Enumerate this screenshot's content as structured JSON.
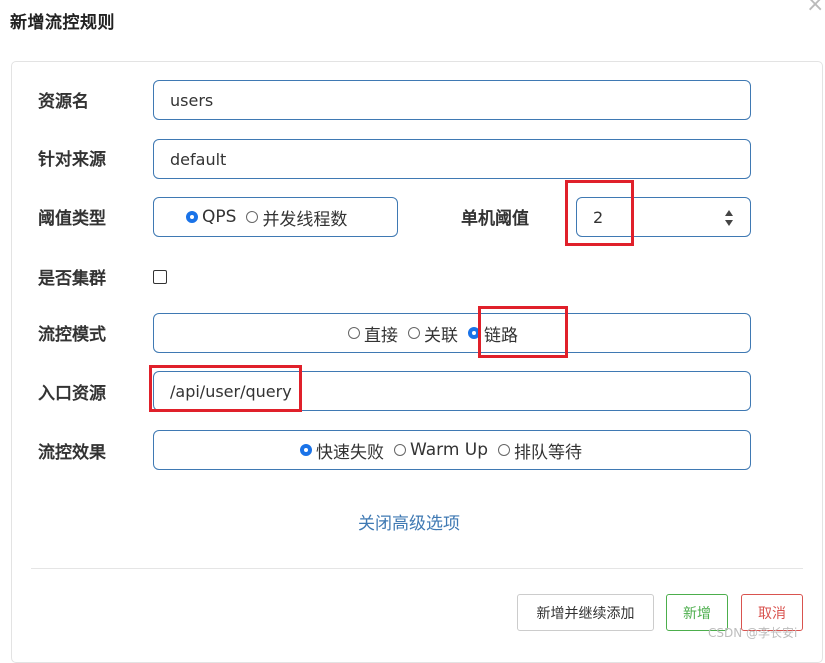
{
  "dialog": {
    "title": "新增流控规则"
  },
  "form": {
    "resource_name": {
      "label": "资源名",
      "value": "users"
    },
    "limit_app": {
      "label": "针对来源",
      "value": "default"
    },
    "grade": {
      "label": "阈值类型",
      "options": [
        "QPS",
        "并发线程数"
      ],
      "selected": "QPS"
    },
    "threshold": {
      "label": "单机阈值",
      "value": "2"
    },
    "cluster": {
      "label": "是否集群",
      "checked": false
    },
    "strategy": {
      "label": "流控模式",
      "options": [
        "直接",
        "关联",
        "链路"
      ],
      "selected": "链路"
    },
    "ref_resource": {
      "label": "入口资源",
      "value": "/api/user/query"
    },
    "control_behavior": {
      "label": "流控效果",
      "options": [
        "快速失败",
        "Warm Up",
        "排队等待"
      ],
      "selected": "快速失败"
    }
  },
  "advanced_toggle": "关闭高级选项",
  "buttons": {
    "add_continue": "新增并继续添加",
    "add": "新增",
    "cancel": "取消"
  },
  "close_icon": "×",
  "watermark": "CSDN @李长安i",
  "colors": {
    "accent": "#3f79b3",
    "highlight": "#e0202a",
    "success": "#4cae4c",
    "danger": "#d9534f"
  }
}
